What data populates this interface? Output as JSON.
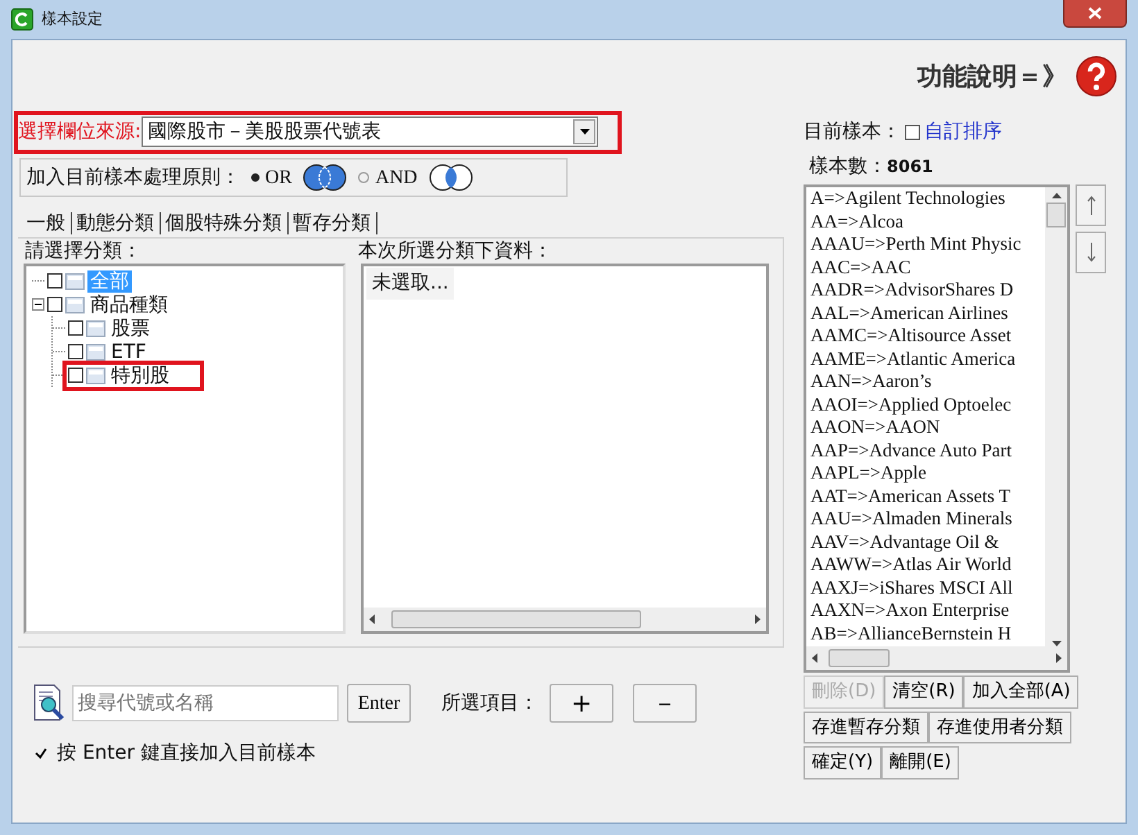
{
  "window": {
    "title": "樣本設定"
  },
  "help": {
    "label": "功能說明＝》"
  },
  "source": {
    "label": "選擇欄位來源:",
    "value": "國際股市－美股股票代號表",
    "highlighted": true
  },
  "rule": {
    "label": "加入目前樣本處理原則：",
    "options": [
      {
        "label": "OR",
        "selected": true,
        "kind": "union"
      },
      {
        "label": "AND",
        "selected": false,
        "kind": "intersection"
      }
    ]
  },
  "tabs": [
    {
      "label": "一般"
    },
    {
      "label": "動態分類"
    },
    {
      "label": "個股特殊分類"
    },
    {
      "label": "暫存分類"
    }
  ],
  "category_pane": {
    "label": "請選擇分類：",
    "tree": [
      {
        "label": "全部",
        "checked": false,
        "selected": true,
        "highlighted": false
      },
      {
        "label": "商品種類",
        "checked": false,
        "selected": false,
        "highlighted": false,
        "expanded": true,
        "children": [
          {
            "label": "股票",
            "checked": false,
            "selected": false,
            "highlighted": false
          },
          {
            "label": "ETF",
            "checked": false,
            "selected": false,
            "highlighted": false
          },
          {
            "label": "特別股",
            "checked": false,
            "selected": false,
            "highlighted": true
          }
        ]
      }
    ]
  },
  "data_pane": {
    "label": "本次所選分類下資料：",
    "items": [
      "未選取..."
    ]
  },
  "search": {
    "placeholder": "搜尋代號或名稱",
    "button": "Enter"
  },
  "selected_items": {
    "label": "所選項目：",
    "buttons": [
      "+",
      "－"
    ]
  },
  "enter_option": {
    "label": "按 Enter 鍵直接加入目前樣本",
    "checked": true
  },
  "sample": {
    "label": "目前樣本：",
    "custom_sort": {
      "label": "自訂排序",
      "checked": false
    },
    "count_label": "樣本數：",
    "count": "8061",
    "items": [
      "A=>Agilent Technologies",
      "AA=>Alcoa",
      "AAAU=>Perth Mint Physic",
      "AAC=>AAC",
      "AADR=>AdvisorShares D",
      "AAL=>American Airlines",
      "AAMC=>Altisource Asset",
      "AAME=>Atlantic America",
      "AAN=>Aaron’s",
      "AAOI=>Applied Optoelec",
      "AAON=>AAON",
      "AAP=>Advance Auto Part",
      "AAPL=>Apple",
      "AAT=>American Assets T",
      "AAU=>Almaden Minerals",
      "AAV=>Advantage Oil &",
      "AAWW=>Atlas Air World",
      "AAXJ=>iShares MSCI All",
      "AAXN=>Axon Enterprise",
      "AB=>AllianceBernstein H"
    ]
  },
  "actions": [
    [
      {
        "label": "刪除(D)",
        "disabled": true
      },
      {
        "label": "清空(R)",
        "disabled": false
      },
      {
        "label": "加入全部(A)",
        "disabled": false
      }
    ],
    [
      {
        "label": "存進暫存分類",
        "disabled": false
      },
      {
        "label": "存進使用者分類",
        "disabled": false
      }
    ],
    [
      {
        "label": "確定(Y)",
        "disabled": false
      },
      {
        "label": "離開(E)",
        "disabled": false
      }
    ]
  ]
}
